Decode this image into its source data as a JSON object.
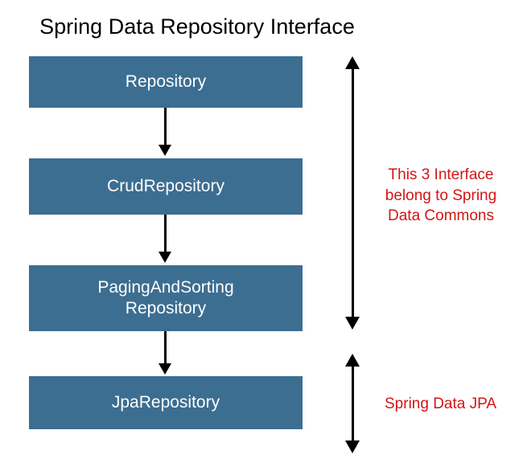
{
  "title": "Spring Data Repository Interface",
  "boxes": {
    "repository": "Repository",
    "crud": "CrudRepository",
    "paging": "PagingAndSorting\nRepository",
    "jpa": "JpaRepository"
  },
  "annotations": {
    "commons": "This 3 Interface belong to Spring Data Commons",
    "jpa": "Spring Data JPA"
  }
}
